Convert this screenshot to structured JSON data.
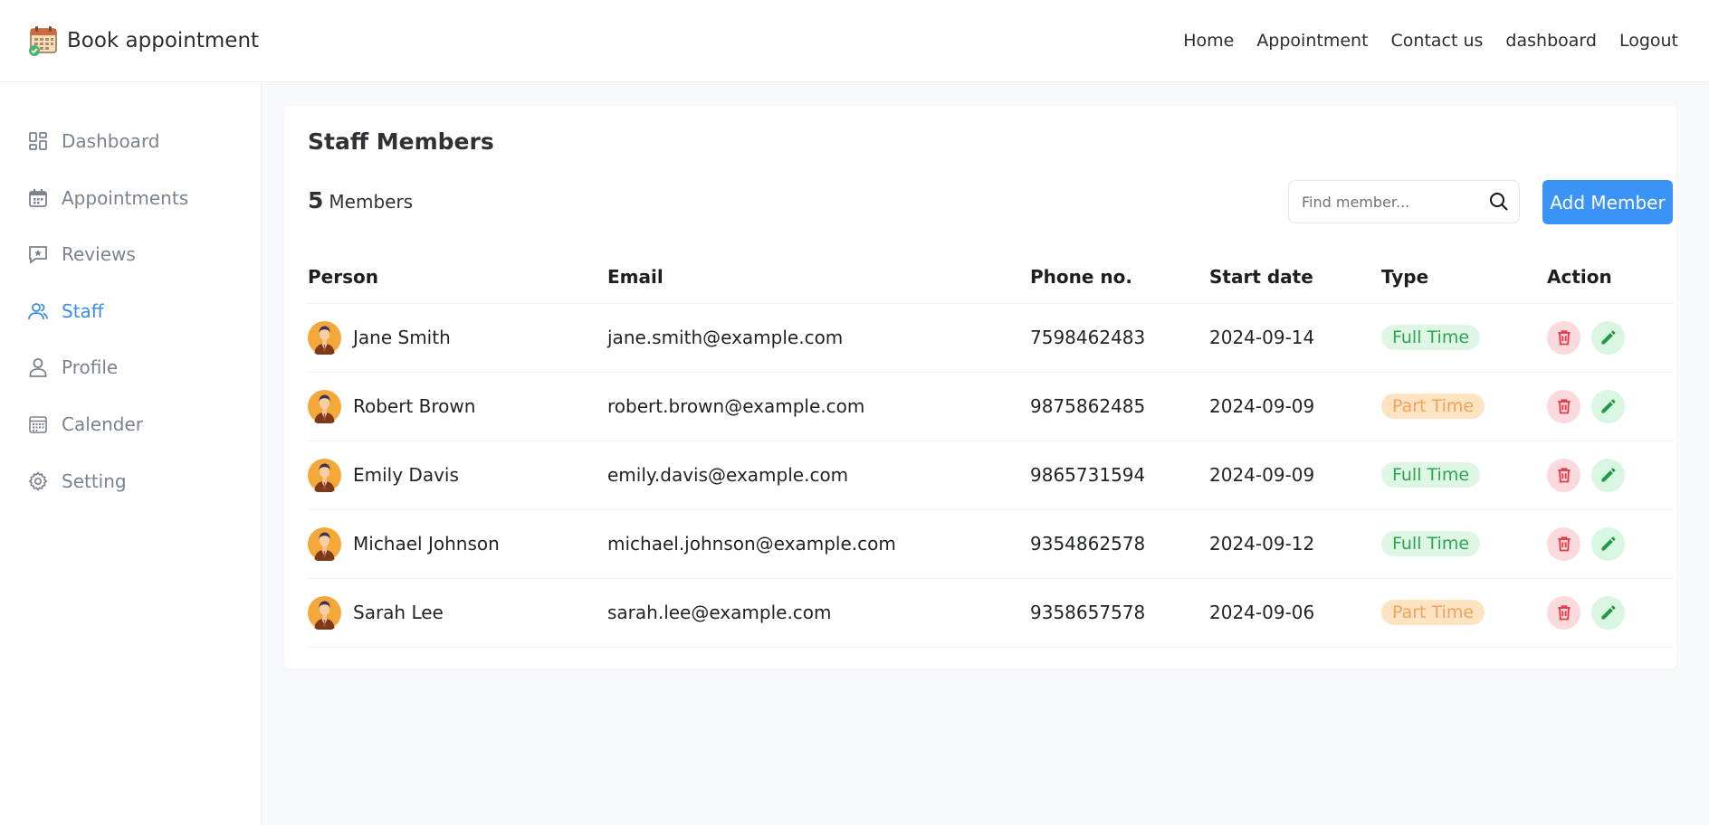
{
  "header": {
    "brand": "Book appointment",
    "nav": [
      "Home",
      "Appointment",
      "Contact us",
      "dashboard",
      "Logout"
    ]
  },
  "sidebar": {
    "items": [
      {
        "label": "Dashboard",
        "icon": "dashboard-icon"
      },
      {
        "label": "Appointments",
        "icon": "calendar-icon"
      },
      {
        "label": "Reviews",
        "icon": "review-icon"
      },
      {
        "label": "Staff",
        "icon": "staff-icon",
        "active": true
      },
      {
        "label": "Profile",
        "icon": "user-icon"
      },
      {
        "label": "Calender",
        "icon": "calendar-grid-icon"
      },
      {
        "label": "Setting",
        "icon": "gear-icon"
      }
    ]
  },
  "main": {
    "title": "Staff Members",
    "count": "5",
    "count_label": "Members",
    "search_placeholder": "Find member...",
    "add_button": "Add Member",
    "columns": [
      "Person",
      "Email",
      "Phone no.",
      "Start date",
      "Type",
      "Action"
    ],
    "rows": [
      {
        "name": "Jane Smith",
        "email": "jane.smith@example.com",
        "phone": "7598462483",
        "start": "2024-09-14",
        "type": "Full Time"
      },
      {
        "name": "Robert Brown",
        "email": "robert.brown@example.com",
        "phone": "9875862485",
        "start": "2024-09-09",
        "type": "Part Time"
      },
      {
        "name": "Emily Davis",
        "email": "emily.davis@example.com",
        "phone": "9865731594",
        "start": "2024-09-09",
        "type": "Full Time"
      },
      {
        "name": "Michael Johnson",
        "email": "michael.johnson@example.com",
        "phone": "9354862578",
        "start": "2024-09-12",
        "type": "Full Time"
      },
      {
        "name": "Sarah Lee",
        "email": "sarah.lee@example.com",
        "phone": "9358657578",
        "start": "2024-09-06",
        "type": "Part Time"
      }
    ]
  },
  "colors": {
    "accent": "#3a93f5",
    "active_nav": "#3b8de8",
    "full_time_bg": "#ddf7e4",
    "full_time_text": "#2fa452",
    "part_time_bg": "#fde3c2",
    "part_time_text": "#f0a35c",
    "delete": "#e23b46",
    "edit": "#1f9a45"
  }
}
